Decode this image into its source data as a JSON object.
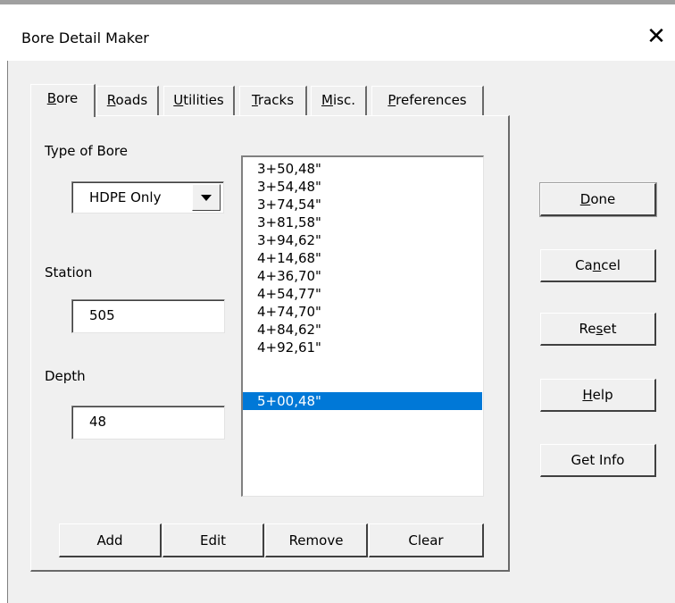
{
  "window": {
    "title": "Bore Detail Maker",
    "close_glyph": "✕"
  },
  "tabs": [
    {
      "label": "Bore",
      "mnemonic": "B",
      "rest": "ore",
      "active": true
    },
    {
      "label": "Roads",
      "mnemonic": "R",
      "rest": "oads"
    },
    {
      "label": "Utilities",
      "mnemonic": "U",
      "rest": "tilities"
    },
    {
      "label": "Tracks",
      "mnemonic": "T",
      "rest": "racks"
    },
    {
      "label": "Misc.",
      "mnemonic": "M",
      "rest": "isc."
    },
    {
      "label": "Preferences",
      "mnemonic": "P",
      "rest": "references"
    }
  ],
  "bore_tab": {
    "type_label": "Type of Bore",
    "type_value": "HDPE Only",
    "station_label": "Station",
    "station_value": "505",
    "depth_label": "Depth",
    "depth_value": "48",
    "list_items": [
      "3+50,48\"",
      "3+54,48\"",
      "3+74,54\"",
      "3+81,58\"",
      "3+94,62\"",
      "4+14,68\"",
      "4+36,70\"",
      "4+54,77\"",
      "4+74,70\"",
      "4+84,62\"",
      "4+92,61\"",
      "5+00,48\""
    ],
    "selected_index": 11,
    "buttons": {
      "add": "Add",
      "edit": "Edit",
      "remove": "Remove",
      "clear": "Clear"
    }
  },
  "side_buttons": {
    "done": {
      "pre": "",
      "mnemonic": "D",
      "post": "one"
    },
    "cancel": {
      "pre": "Ca",
      "mnemonic": "n",
      "post": "cel"
    },
    "reset": {
      "pre": "Re",
      "mnemonic": "s",
      "post": "et"
    },
    "help": {
      "pre": "",
      "mnemonic": "H",
      "post": "elp"
    },
    "get_info": "Get Info"
  },
  "colors": {
    "selection": "#0078d7",
    "face": "#f0f0f0"
  },
  "icons": [
    "close-icon",
    "dropdown-arrow-icon"
  ]
}
